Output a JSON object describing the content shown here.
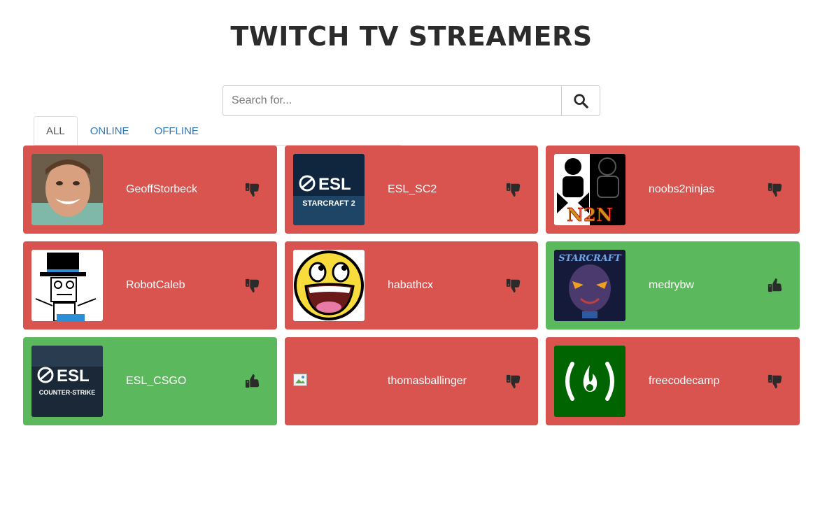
{
  "header": {
    "title": "TWITCH TV STREAMERS"
  },
  "search": {
    "placeholder": "Search for...",
    "value": "",
    "button_icon": "search-icon"
  },
  "tabs": [
    {
      "label": "ALL",
      "active": true
    },
    {
      "label": "ONLINE",
      "active": false
    },
    {
      "label": "OFFLINE",
      "active": false
    }
  ],
  "colors": {
    "offline": "#d9534f",
    "online": "#5cb85c",
    "link": "#337ab7"
  },
  "streamers": [
    {
      "name": "GeoffStorbeck",
      "status": "offline",
      "icon": "thumbs-down-icon"
    },
    {
      "name": "ESL_SC2",
      "status": "offline",
      "icon": "thumbs-down-icon"
    },
    {
      "name": "noobs2ninjas",
      "status": "offline",
      "icon": "thumbs-down-icon"
    },
    {
      "name": "RobotCaleb",
      "status": "offline",
      "icon": "thumbs-down-icon"
    },
    {
      "name": "habathcx",
      "status": "offline",
      "icon": "thumbs-down-icon"
    },
    {
      "name": "medrybw",
      "status": "online",
      "icon": "thumbs-up-icon"
    },
    {
      "name": "ESL_CSGO",
      "status": "online",
      "icon": "thumbs-up-icon"
    },
    {
      "name": "thomasballinger",
      "status": "offline",
      "icon": "thumbs-down-icon"
    },
    {
      "name": "freecodecamp",
      "status": "offline",
      "icon": "thumbs-down-icon"
    }
  ],
  "logos": {
    "esl_sc2": {
      "brand": "ESL",
      "game": "STARCRAFT 2"
    },
    "esl_csgo": {
      "brand": "ESL",
      "game": "COUNTER-STRIKE"
    },
    "noobs2ninjas": {
      "mark": "N2N"
    },
    "medrybw": {
      "mark": "STARCRAFT"
    }
  }
}
